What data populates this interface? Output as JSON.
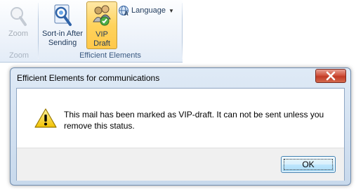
{
  "ribbon": {
    "zoom_button_label": "Zoom",
    "zoom_group_label": "Zoom",
    "sortin_button_label": "Sort-in After\nSending",
    "vip_button_label": "VIP\nDraft",
    "language_button_label": "Language",
    "efficient_group_label": "Efficient Elements"
  },
  "dialog": {
    "title": "Efficient Elements for communications",
    "message": "This mail has been marked as VIP-draft. It can not be sent unless you remove this status.",
    "ok_label": "OK"
  },
  "icons": {
    "zoom": "magnifier-icon",
    "sortin": "sort-in-icon",
    "vip": "vip-draft-icon",
    "language": "language-icon",
    "warning": "warning-icon",
    "close": "close-icon"
  },
  "colors": {
    "vip_pressed": "#ffd35c",
    "close_button": "#c23a26",
    "warning_yellow": "#f7d21c"
  }
}
